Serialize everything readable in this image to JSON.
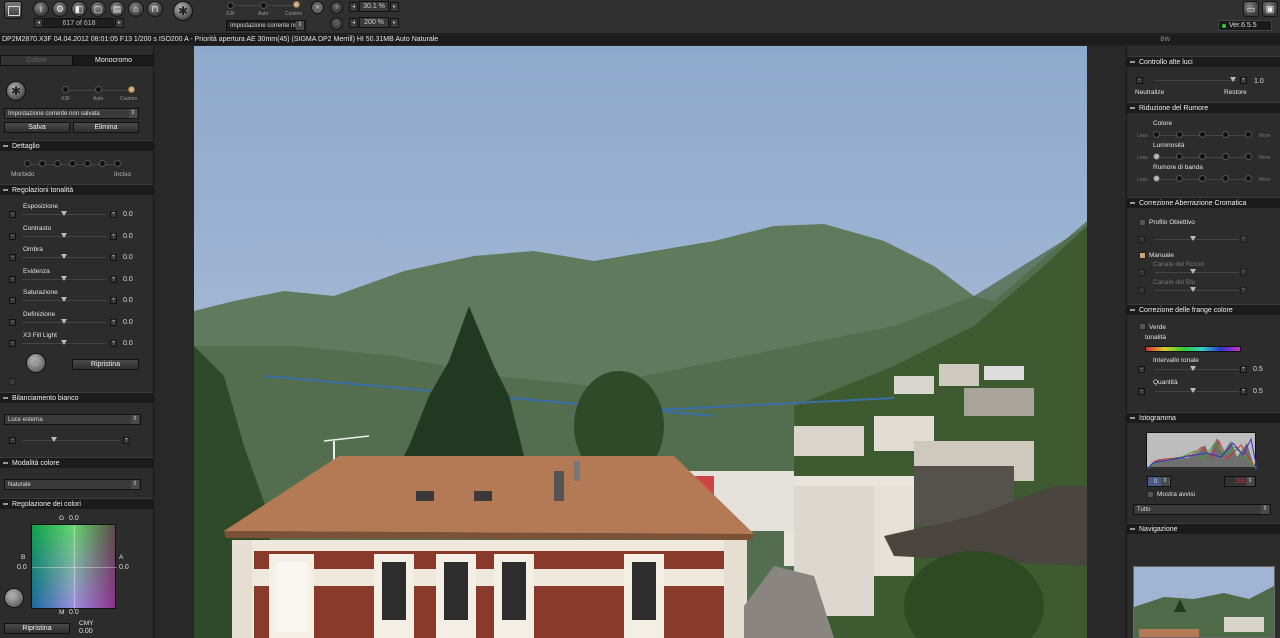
{
  "toolbar": {
    "file_counter": "617 of 618",
    "mode_labels": [
      "X3F",
      "Auto",
      "Custom"
    ],
    "setting_value": "Impostazione corrente no",
    "zoom_primary": "30.1 %",
    "zoom_secondary": "200 %",
    "version": "Ver.6.5.5"
  },
  "info_line": "DP2M2870.X3F 04.04.2012 08:01:05 F13 1/200 s ISO200 A - Priorità apertura AE 30mm(45) (SIGMA DP2 Merrill) HI 50.31MB Auto Naturale",
  "bw_label": "BW",
  "left": {
    "tabs": [
      "Colore",
      "Monocromo"
    ],
    "mode_labels": [
      "X3F",
      "Auto",
      "Custom"
    ],
    "preset_select": "Impostazione corrente non salvata",
    "save_button": "Salva",
    "delete_button": "Elimina",
    "detail_title": "Dettaglio",
    "detail_left": "Morbido",
    "detail_right": "Inciso",
    "tone_title": "Regolazioni tonalità",
    "tone_sliders": [
      {
        "label": "Esposizione",
        "value": "0.0"
      },
      {
        "label": "Contrasto",
        "value": "0.0"
      },
      {
        "label": "Ombra",
        "value": "0.0"
      },
      {
        "label": "Evidenza",
        "value": "0.0"
      },
      {
        "label": "Saturazione",
        "value": "0.0"
      },
      {
        "label": "Definizione",
        "value": "0.0"
      },
      {
        "label": "X3 Fill Light",
        "value": "0.0"
      }
    ],
    "reset_button": "Ripristina",
    "wb_title": "Bilanciamento bianco",
    "wb_select": "Luce esterna",
    "color_mode_title": "Modalità colore",
    "color_mode_select": "Naturale",
    "color_adjust_title": "Regolazione dei colori",
    "g_label": "G",
    "g_value": "0.0",
    "b_label": "B",
    "b_value": "0.0",
    "a_label": "A",
    "a_value": "0.0",
    "m_label": "M",
    "m_value": "0.0",
    "reset_button_2": "Ripristina",
    "cmy_label": "CMY",
    "cmy_value": "0.00"
  },
  "right": {
    "highlight_title": "Controllo alte luci",
    "highlight_value": "1.0",
    "neutralize": "Neutralize",
    "restore": "Restore",
    "noise_title": "Riduzione del Rumore",
    "noise_colore": "Colore",
    "noise_luminosita": "Luminosità",
    "noise_banda": "Rumore di banda",
    "less_label": "Less",
    "more_label": "More",
    "chrom_title": "Correzione Aberrazione Cromatica",
    "lens_profile": "Profilo Obiettivo",
    "manual": "Manuale",
    "red_channel": "Canale del Rosso",
    "blue_channel": "Canale del Blu",
    "fringe_title": "Correzione delle frange colore",
    "fringe_green": "Verde",
    "fringe_hue": "tonalità",
    "tone_range_label": "Intervallo tonale",
    "tone_range_value": "0.5",
    "quantity_label": "Quantità",
    "quantity_value": "0.5",
    "histogram_title": "Istogramma",
    "hist_low": "0",
    "hist_high": "255",
    "show_warnings": "Mostra avvisi",
    "histogram_select": "Tutto",
    "navigation_title": "Navigazione"
  },
  "colors": {
    "accent": "#d2b48c",
    "panel": "#2c2c2c",
    "header": "#1b1b1b",
    "status_green": "#33cc33"
  }
}
